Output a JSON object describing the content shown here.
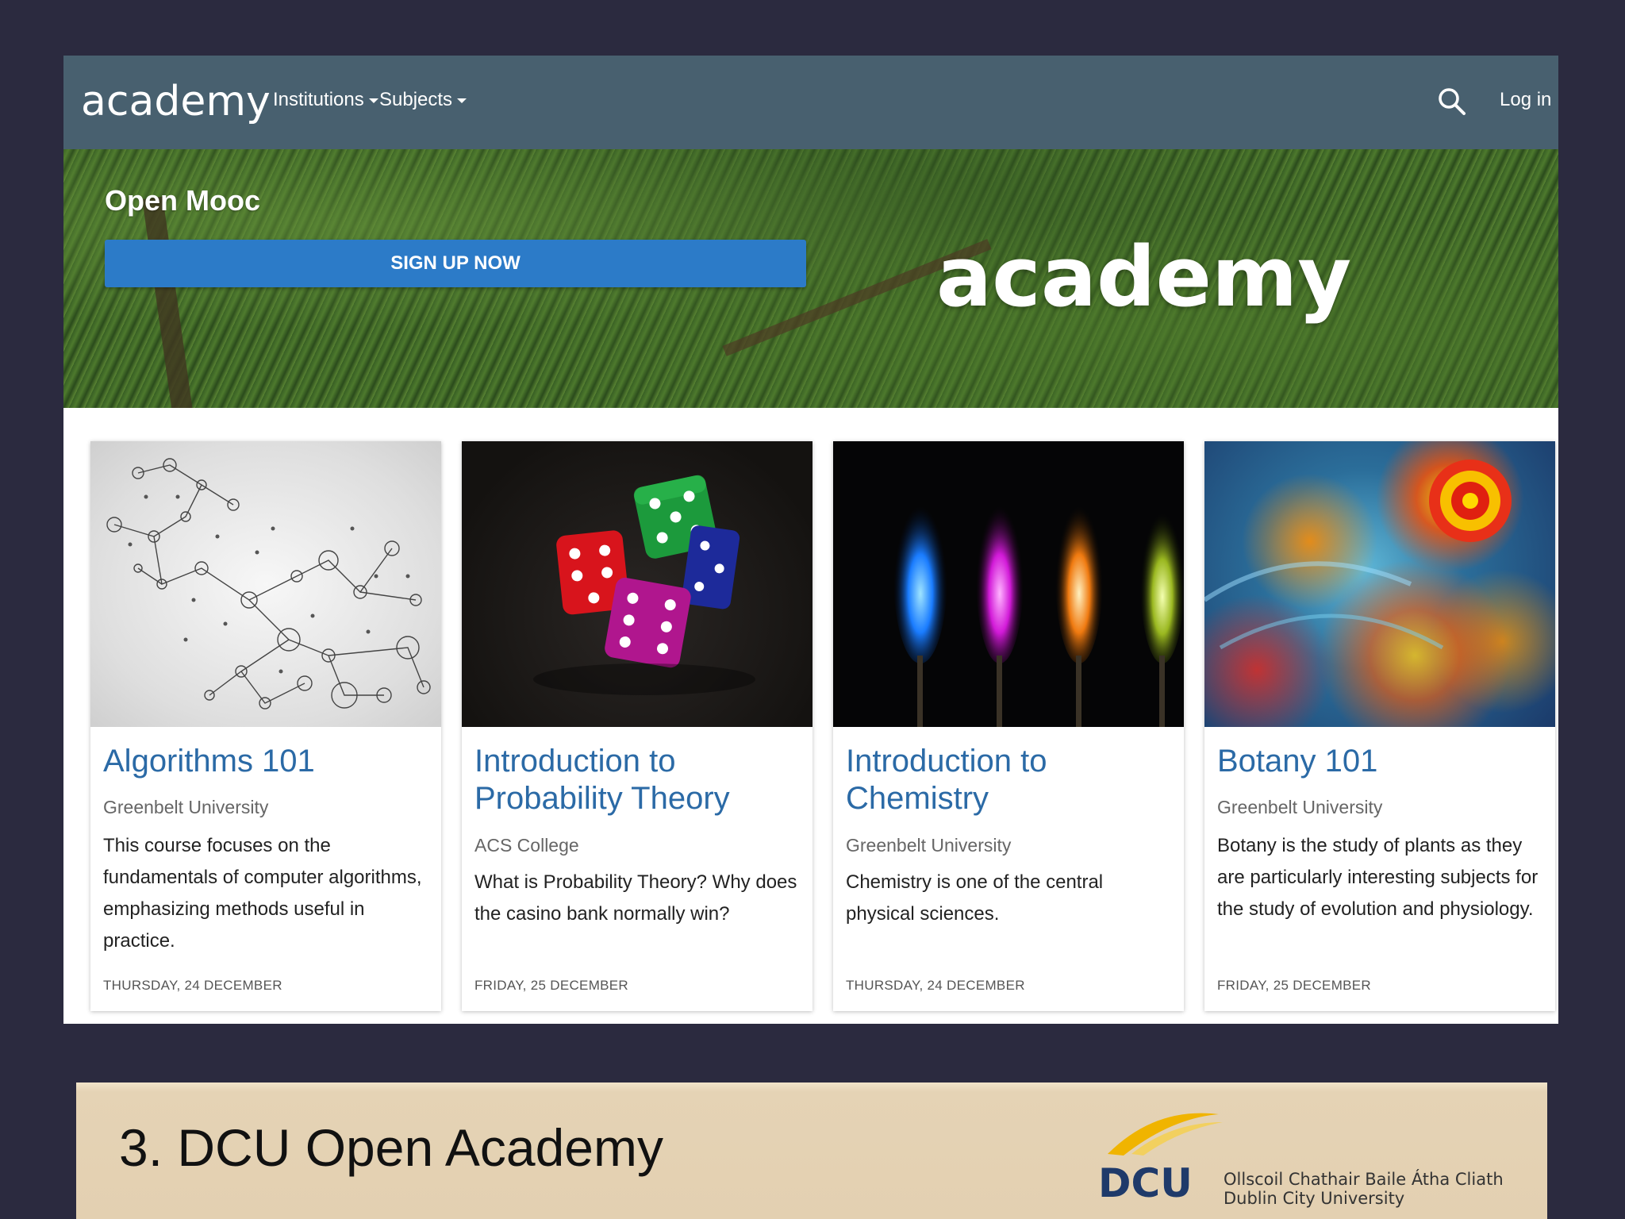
{
  "navbar": {
    "brand": "academy",
    "items": [
      {
        "label": "Institutions"
      },
      {
        "label": "Subjects"
      }
    ],
    "login_label": "Log in"
  },
  "hero": {
    "title": "Open Mooc",
    "signup_label": "SIGN UP NOW",
    "logo_text": "academy"
  },
  "cards": [
    {
      "title": "Algorithms 101",
      "institution": "Greenbelt University",
      "description": "This course focuses on the fundamentals of computer algorithms, emphasizing methods useful in practice.",
      "date": "THURSDAY, 24 DECEMBER"
    },
    {
      "title": "Introduction to Probability Theory",
      "institution": "ACS College",
      "description": "What is Probability Theory? Why does the casino bank normally win?",
      "date": "FRIDAY, 25 DECEMBER"
    },
    {
      "title": "Introduction to Chemistry",
      "institution": "Greenbelt University",
      "description": "Chemistry is one of the central physical sciences.",
      "date": "THURSDAY, 24 DECEMBER"
    },
    {
      "title": "Botany 101",
      "institution": "Greenbelt University",
      "description": "Botany is the study of plants as they are particularly interesting subjects for the study of evolution and physiology.",
      "date": "FRIDAY, 25 DECEMBER"
    }
  ],
  "slide": {
    "title": "3. DCU Open Academy",
    "logo_text": "DCU",
    "logo_subtitle_irish": "Ollscoil Chathair Baile Átha Cliath",
    "logo_subtitle_english": "Dublin City University"
  },
  "colors": {
    "navbar": "#48606f",
    "signup_button": "#2c7bc8",
    "card_title": "#2b6aa6",
    "slide_background": "#2b2a3f",
    "footer_bar": "#e3d0b1"
  }
}
